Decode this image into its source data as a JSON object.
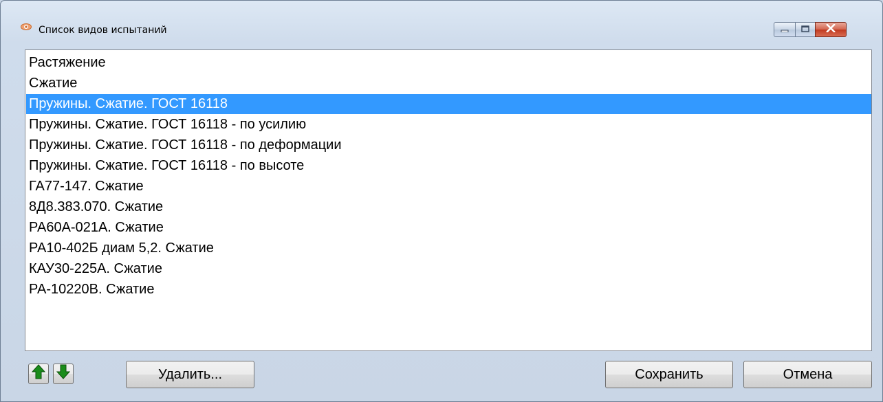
{
  "window": {
    "title": "Список видов испытаний",
    "controls": [
      "minimize-icon",
      "maximize-icon",
      "close-icon"
    ]
  },
  "list": {
    "items": [
      "Растяжение",
      "Сжатие",
      "Пружины. Сжатие. ГОСТ 16118",
      "Пружины. Сжатие. ГОСТ 16118 - по усилию",
      "Пружины. Сжатие. ГОСТ 16118 - по деформации",
      "Пружины. Сжатие. ГОСТ 16118 - по высоте",
      "ГА77-147. Сжатие",
      "8Д8.383.070. Сжатие",
      "РА60А-021А. Сжатие",
      "РА10-402Б диам 5,2. Сжатие",
      "КАУ30-225А. Сжатие",
      "РА-10220В. Сжатие"
    ],
    "selected_index": 2
  },
  "buttons": {
    "move_up_icon": "arrow-up-icon",
    "move_down_icon": "arrow-down-icon",
    "delete_label": "Удалить...",
    "save_label": "Сохранить",
    "cancel_label": "Отмена"
  },
  "colors": {
    "selection": "#3399ff",
    "arrow_green": "#1a8c1a"
  }
}
